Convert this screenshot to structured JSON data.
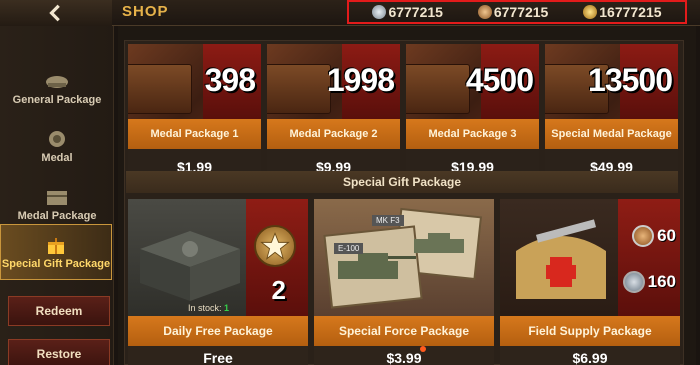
{
  "header": {
    "title": "SHOP",
    "currencies": [
      {
        "icon": "silver-medal-icon",
        "value": "6777215"
      },
      {
        "icon": "bronze-medal-icon",
        "value": "6777215"
      },
      {
        "icon": "star-medal-icon",
        "value": "16777215"
      }
    ]
  },
  "sidebar": {
    "items": [
      {
        "label": "General Package",
        "icon": "cap-icon"
      },
      {
        "label": "Medal",
        "icon": "medal-icon"
      },
      {
        "label": "Medal Package",
        "icon": "chest-icon"
      },
      {
        "label": "Special Gift Package",
        "icon": "gift-icon",
        "active": true
      }
    ],
    "redeem_label": "Redeem",
    "restore_label": "Restore"
  },
  "medal_packages": [
    {
      "amount": "398",
      "name": "Medal Package 1",
      "price": "$1.99"
    },
    {
      "amount": "1998",
      "name": "Medal Package 2",
      "price": "$9.99"
    },
    {
      "amount": "4500",
      "name": "Medal Package 3",
      "price": "$19.99"
    },
    {
      "amount": "13500",
      "name": "Special Medal Package",
      "price": "$49.99"
    }
  ],
  "special_section": {
    "title": "Special Gift Package"
  },
  "gift_packages": [
    {
      "name": "Daily Free Package",
      "price": "Free",
      "stock_label": "In stock:",
      "stock_value": "1",
      "count": "2"
    },
    {
      "name": "Special Force Package",
      "price": "$3.99",
      "tag": "MK F3",
      "tag2": "E-100"
    },
    {
      "name": "Field Supply Package",
      "price": "$6.99",
      "bronze_count": "60",
      "silver_count": "160"
    }
  ],
  "colors": {
    "accent": "#e6b24a",
    "highlight_box": "#e21b1b",
    "tab_orange": "#d6781c"
  }
}
